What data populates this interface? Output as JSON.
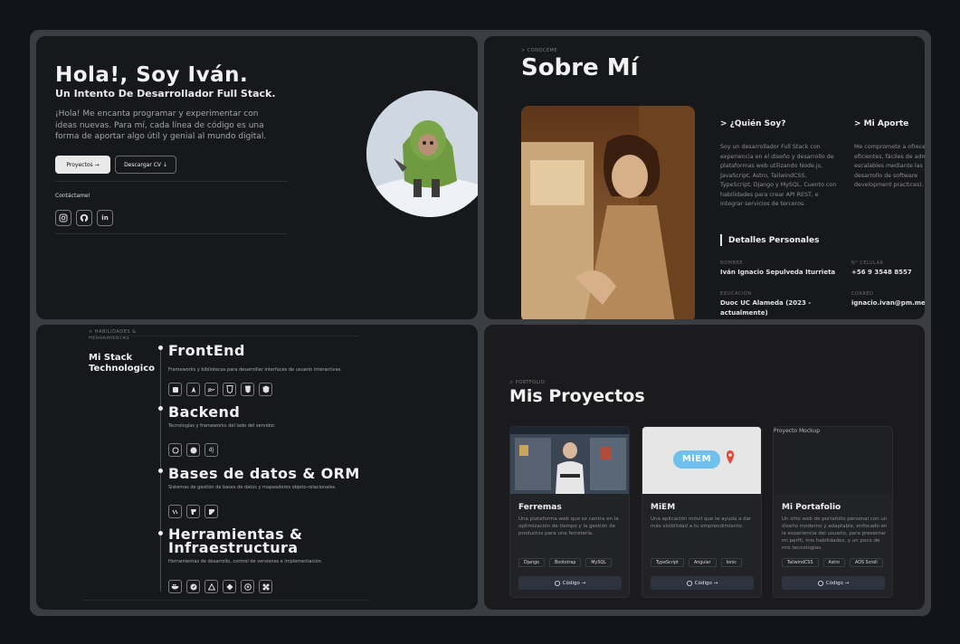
{
  "hero": {
    "title": "Hola!, Soy Iván.",
    "subtitle": "Un Intento De Desarrollador Full Stack.",
    "description": "¡Hola! Me encanta programar y experimentar con ideas nuevas. Para mí, cada línea de código es una forma de aportar algo útil y genial al mundo digital.",
    "btn_projects": "Proyectos →",
    "btn_cv": "Descargar CV ↓",
    "contact_label": "Contáctame!",
    "socials": [
      "instagram-icon",
      "github-icon",
      "linkedin-icon"
    ]
  },
  "about": {
    "eyebrow": "> CONOCEME",
    "title": "Sobre Mí",
    "who_title": "> ¿Quién Soy?",
    "who_text": "Soy un desarrollador Full Stack con experiencia en el diseño y desarrollo de plataformas web utilizando Node.js, JavaScript, Astro, TailwindCSS, TypeScript, Django y MySQL. Cuento con habilidades para crear API REST, e integrar servicios de terceros.",
    "contrib_title": "> Mi Aporte",
    "contrib_text": "Me comprometo a ofrece eficientes, fáciles de adm escalables mediante las m de desarrollo de software development practices).",
    "details_title": "Detalles Personales",
    "details": {
      "name_label": "NOMBRE",
      "name_value": "Iván Ignacio Sepulveda Iturrieta",
      "phone_label": "N° CELULAR",
      "phone_value": "+56 9 3548 8557",
      "edu_label": "EDUCACIÓN",
      "edu_value": "Duoc UC Alameda (2023 - actualmente)",
      "email_label": "CORREO",
      "email_value": "ignacio.ivan@pm.me"
    }
  },
  "stack": {
    "eyebrow": "> HABILIDADES & HERRAMIENTAS",
    "title": "Mi Stack Technologico",
    "sections": [
      {
        "title": "FrontEnd",
        "desc": "Frameworks y bibliotecas para desarrollar interfaces de usuario interactivas.",
        "icons": [
          "astro-icon",
          "svelte-icon",
          "tailwind-icon",
          "css-icon",
          "html-icon",
          "angular-icon"
        ]
      },
      {
        "title": "Backend",
        "desc": "Tecnologías y frameworks del lado del servidor.",
        "icons": [
          "node-icon",
          "express-icon",
          "django-icon"
        ]
      },
      {
        "title": "Bases de datos & ORM",
        "desc": "Sistemas de gestión de bases de datos y mapeadores objeto-relacionales.",
        "icons": [
          "drizzle-icon",
          "mysql-icon",
          "prisma-icon"
        ]
      },
      {
        "title": "Herramientas & Infraestructura",
        "desc": "Herramientas de desarrollo, control de versiones e implementación.",
        "icons": [
          "docker-icon",
          "postman-icon",
          "vercel-icon",
          "git-icon",
          "github-icon",
          "figma-icon"
        ]
      }
    ],
    "django_glyph": "dj"
  },
  "projects": {
    "eyebrow": "> PORTFOLIO",
    "title": "Mis Proyectos",
    "mock_label": "Proyecto Mockup",
    "code_label": "Código →",
    "miem_logo": "MiEM",
    "cards": [
      {
        "name": "Ferremas",
        "desc": "Una plataforma web que se centra en la optimización de tiempo y la gestión de productos para una ferretería.",
        "tags": [
          "Django",
          "Bootstrap",
          "MySQL"
        ]
      },
      {
        "name": "MiEM",
        "desc": "Una aplicación móvil que te ayuda a dar más visibilidad a tu emprendimiento.",
        "tags": [
          "TypeScript",
          "Angular",
          "Ionic"
        ]
      },
      {
        "name": "Mi Portafolio",
        "desc": "Un sitio web de portafolio personal con un diseño moderno y adaptable, enfocado en la experiencia del usuario, para presentar mi perfil, mis habilidades, y un poco de mis tecnologías.",
        "tags": [
          "TailwindCSS",
          "Astro",
          "AOS Scroll"
        ]
      }
    ]
  },
  "colors": {
    "background": "#111419",
    "panel": "#17181b",
    "frame": "#3a3d42",
    "button_dark": "#2e3340"
  }
}
